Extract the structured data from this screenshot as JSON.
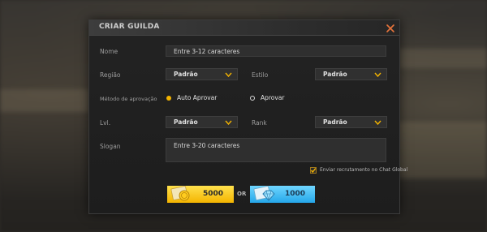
{
  "dialog": {
    "title": "CRIAR GUILDA",
    "name_label": "Nome",
    "name_placeholder": "Entre 3-12 caracteres",
    "region_label": "Região",
    "region_value": "Padrão",
    "style_label": "Estilo",
    "style_value": "Padrão",
    "approval_label": "Método de aprovação",
    "approval_options": [
      "Auto Aprovar",
      "Aprovar"
    ],
    "approval_selected": "Auto Aprovar",
    "level_label": "Lvl.",
    "level_value": "Padrão",
    "rank_label": "Rank",
    "rank_value": "Padrão",
    "slogan_label": "Slogan",
    "slogan_placeholder": "Entre 3-20 caracteres",
    "recruit_checkbox_label": "Enviar recrutamento no Chat Global",
    "recruit_checked": true,
    "or_text": "OR",
    "gold_price": "5000",
    "diamond_price": "1000"
  },
  "colors": {
    "accent_gold": "#f4b400",
    "accent_blue": "#25a7ea",
    "close_orange": "#e8743b"
  },
  "icons": [
    "close-icon",
    "chevron-down-icon",
    "gold-coin-icon",
    "diamond-icon",
    "checkmark-icon"
  ]
}
